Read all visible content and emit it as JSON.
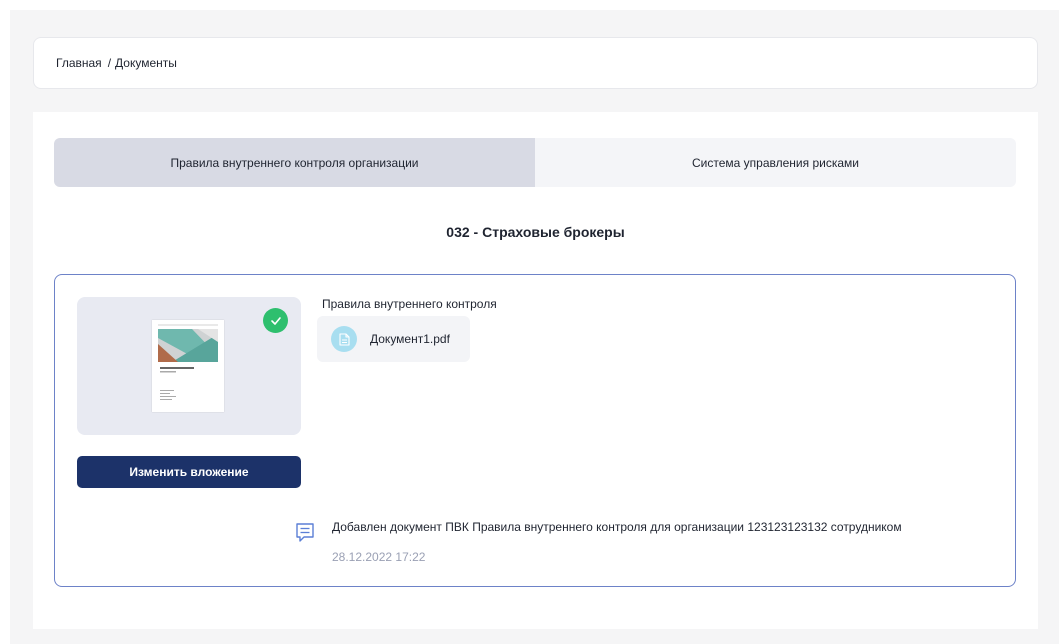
{
  "breadcrumb": {
    "home": "Главная",
    "separator": "/",
    "current": "Документы"
  },
  "tabs": [
    {
      "label": "Правила внутреннего контроля организации",
      "active": true
    },
    {
      "label": "Система управления рисками",
      "active": false
    }
  ],
  "section_title": "032 - Страховые брокеры",
  "document": {
    "preview_icon": "document-thumbnail",
    "status_icon": "check-icon",
    "status_color": "#2ebf6e",
    "change_button_label": "Изменить вложение",
    "attachment_label": "Правила внутреннего контроля",
    "file_icon": "file-icon",
    "file_name": "Документ1.pdf"
  },
  "history": {
    "icon": "message-icon",
    "text": "Добавлен документ ПВК Правила внутреннего контроля для организации 123123123132 сотрудником",
    "date": "28.12.2022 17:22"
  },
  "colors": {
    "primary": "#1c3269",
    "accent_border": "#6d82c8",
    "success": "#2ebf6e",
    "file_icon_bg": "#a8def0"
  }
}
